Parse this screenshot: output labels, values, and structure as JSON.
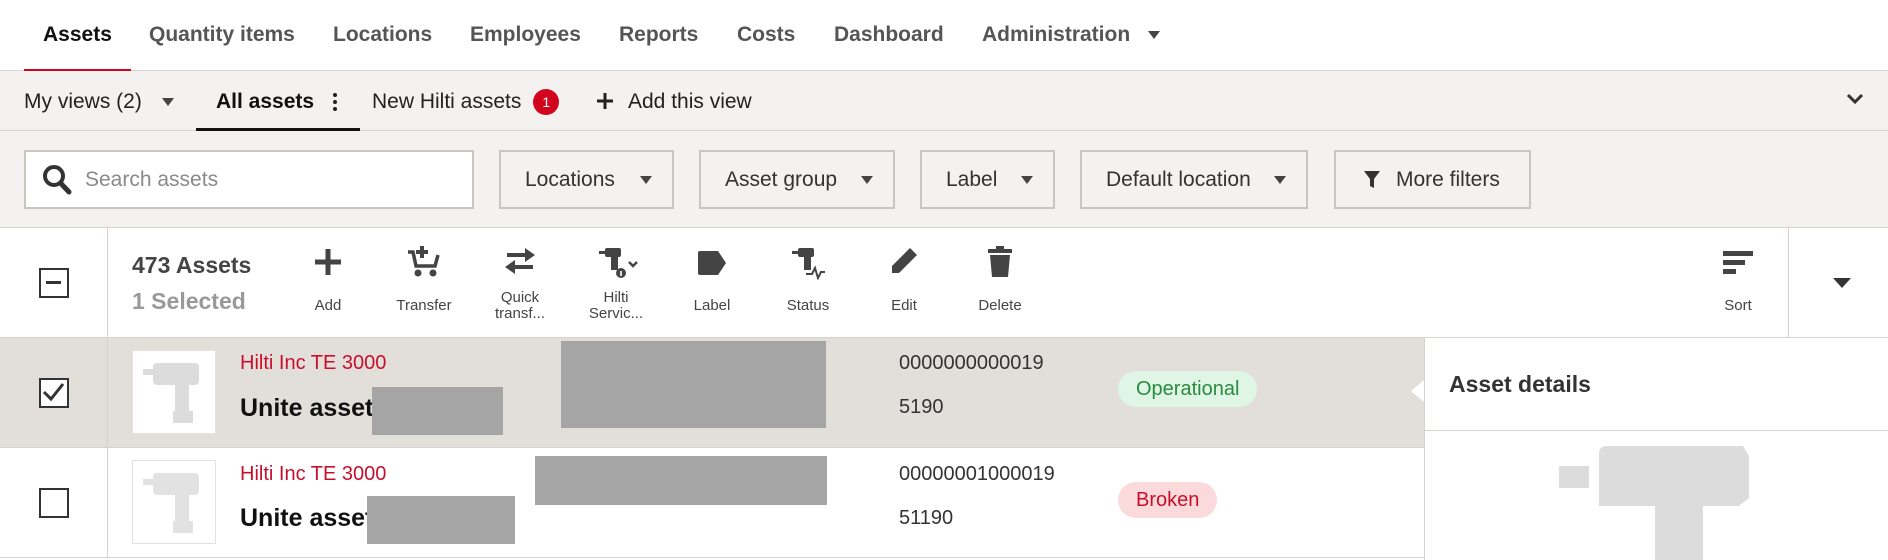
{
  "nav": {
    "tabs": [
      {
        "label": "Assets"
      },
      {
        "label": "Quantity items"
      },
      {
        "label": "Locations"
      },
      {
        "label": "Employees"
      },
      {
        "label": "Reports"
      },
      {
        "label": "Costs"
      },
      {
        "label": "Dashboard"
      },
      {
        "label": "Administration"
      }
    ],
    "active": "Assets"
  },
  "views": {
    "my_views": "My views (2)",
    "all_assets": "All assets",
    "new_hilti": "New Hilti assets",
    "new_hilti_count": "1",
    "add_view": "Add this view"
  },
  "filters": {
    "search_placeholder": "Search assets",
    "locations": "Locations",
    "asset_group": "Asset group",
    "label": "Label",
    "default_location": "Default location",
    "more_filters": "More filters"
  },
  "actionbar": {
    "count": "473 Assets",
    "selected": "1 Selected",
    "actions": {
      "add": "Add",
      "transfer": "Transfer",
      "quick_transfer_1": "Quick",
      "quick_transfer_2": "transf...",
      "hilti_service_1": "Hilti",
      "hilti_service_2": "Servic...",
      "label": "Label",
      "status": "Status",
      "edit": "Edit",
      "delete": "Delete",
      "sort": "Sort"
    }
  },
  "rows": [
    {
      "manufacturer": "Hilti Inc TE 3000",
      "name": "Unite asset",
      "serial": "0000000000019",
      "inventory": "5190",
      "status": "Operational",
      "status_color": "#2a8a3e",
      "selected": true
    },
    {
      "manufacturer": "Hilti Inc TE 3000",
      "name": "Unite asset",
      "serial": "00000001000019",
      "inventory": "51190",
      "status": "Broken",
      "status_color": "#c8102e",
      "selected": false
    }
  ],
  "detail": {
    "title": "Asset details"
  },
  "colors": {
    "accent": "#d2051e",
    "background": "#f3f2f0"
  }
}
